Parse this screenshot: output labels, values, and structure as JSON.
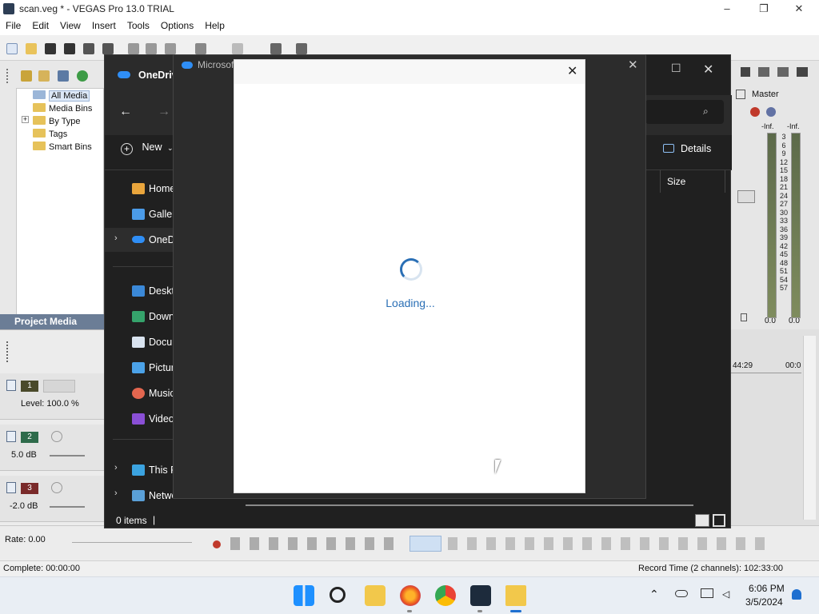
{
  "app": {
    "title": "scan.veg * - VEGAS Pro 13.0 TRIAL",
    "menu": [
      "File",
      "Edit",
      "View",
      "Insert",
      "Tools",
      "Options",
      "Help"
    ]
  },
  "media_tree": {
    "items": [
      "All Media",
      "Media Bins",
      "By Type",
      "Tags",
      "Smart Bins"
    ],
    "expander": "+"
  },
  "project_media_tab": "Project Media",
  "tracks": [
    {
      "number": "1",
      "value": "Level: 100.0 %"
    },
    {
      "number": "2",
      "value": "5.0 dB"
    },
    {
      "number": "3",
      "value": "-2.0 dB"
    }
  ],
  "master": {
    "label": "Master",
    "inf_left": "-Inf.",
    "inf_right": "-Inf.",
    "scale": [
      "3",
      "6",
      "9",
      "12",
      "15",
      "18",
      "21",
      "24",
      "27",
      "30",
      "33",
      "36",
      "39",
      "42",
      "45",
      "48",
      "51",
      "54",
      "57"
    ],
    "bottom_left": "0.0",
    "bottom_right": "0.0"
  },
  "timecodes": {
    "left": "44:29",
    "right": "00:0"
  },
  "rate": "Rate: 0.00",
  "status": {
    "complete": "Complete: 00:00:00",
    "record_time": "Record Time (2 channels): 102:33:00"
  },
  "explorer": {
    "tab_title": "OneDriv",
    "new_label": "New",
    "details_label": "Details",
    "size_header": "Size",
    "sidebar": [
      "Home",
      "Gallery",
      "OneDri",
      "Deskto",
      "Down",
      "Docu",
      "Pictur",
      "Music",
      "Videos",
      "This P",
      "Netwo"
    ],
    "items_count": "0 items",
    "items_sep": "|"
  },
  "dialog_behind": {
    "title": "Microsof"
  },
  "loading_dialog": {
    "text": "Loading..."
  },
  "clock": {
    "time": "6:06 PM",
    "date": "3/5/2024"
  },
  "colors": {
    "accent": "#2a6fb5",
    "dark_bg": "#202020",
    "taskbar": "#e9eef4"
  }
}
